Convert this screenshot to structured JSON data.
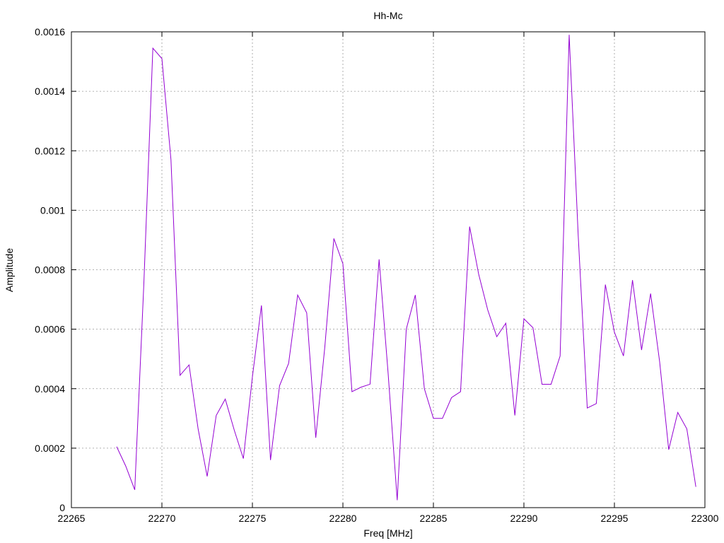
{
  "chart_data": {
    "type": "line",
    "title": "Hh-Mc",
    "xlabel": "Freq [MHz]",
    "ylabel": "Amplitude",
    "xlim": [
      22265,
      22300
    ],
    "ylim": [
      0,
      0.0016
    ],
    "xticks": [
      "22265",
      "22270",
      "22275",
      "22280",
      "22285",
      "22290",
      "22295",
      "22300"
    ],
    "yticks": [
      "0",
      "0.0002",
      "0.0004",
      "0.0006",
      "0.0008",
      "0.001",
      "0.0012",
      "0.0014",
      "0.0016"
    ],
    "grid": true,
    "line_color": "#9400d3",
    "series": [
      {
        "x": [
          22267.5,
          22268.0,
          22268.5,
          22269.0,
          22269.5,
          22270.0,
          22270.5,
          22271.0,
          22271.5,
          22272.0,
          22272.5,
          22273.0,
          22273.5,
          22274.0,
          22274.5,
          22275.0,
          22275.5,
          22276.0,
          22276.5,
          22277.0,
          22277.5,
          22278.0,
          22278.5,
          22279.0,
          22279.5,
          22280.0,
          22280.5,
          22281.0,
          22281.5,
          22282.0,
          22282.5,
          22283.0,
          22283.5,
          22284.0,
          22284.5,
          22285.0,
          22285.5,
          22286.0,
          22286.5,
          22287.0,
          22287.5,
          22288.0,
          22288.5,
          22289.0,
          22289.5,
          22290.0,
          22290.5,
          22291.0,
          22291.5,
          22292.0,
          22292.5,
          22293.0,
          22293.5,
          22294.0,
          22294.5,
          22295.0,
          22295.5,
          22296.0,
          22296.5,
          22297.0,
          22297.5,
          22298.0,
          22298.5,
          22299.0,
          22299.5
        ],
        "y": [
          0.000205,
          0.00014,
          6e-05,
          0.00075,
          0.001545,
          0.00151,
          0.00117,
          0.000445,
          0.00048,
          0.000265,
          0.000105,
          0.00031,
          0.000365,
          0.00026,
          0.000165,
          0.00044,
          0.00068,
          0.00016,
          0.00041,
          0.000485,
          0.000715,
          0.000655,
          0.000235,
          0.00054,
          0.000905,
          0.00082,
          0.00039,
          0.000405,
          0.000415,
          0.000835,
          0.00045,
          2.5e-05,
          0.0006,
          0.000715,
          0.0004,
          0.0003,
          0.0003,
          0.00037,
          0.00039,
          0.000945,
          0.000785,
          0.000665,
          0.000575,
          0.00062,
          0.00031,
          0.000635,
          0.000605,
          0.000415,
          0.000415,
          0.00051,
          0.00159,
          0.000915,
          0.000335,
          0.00035,
          0.00075,
          0.00059,
          0.00051,
          0.000765,
          0.00053,
          0.00072,
          0.00049,
          0.000195,
          0.00032,
          0.000265,
          7e-05
        ]
      }
    ]
  }
}
